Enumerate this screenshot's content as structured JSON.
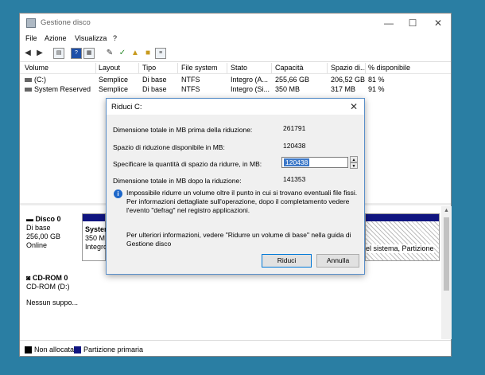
{
  "window": {
    "title": "Gestione disco",
    "controls": {
      "minimize": "—",
      "maximize": "☐",
      "close": "✕"
    }
  },
  "menu": [
    "File",
    "Azione",
    "Visualizza",
    "?"
  ],
  "toolbar": {
    "icons": [
      "back-arrow-icon",
      "forward-arrow-icon",
      "disk-list-icon",
      "help-icon",
      "properties-icon",
      "connect-icon",
      "check-icon",
      "folder-up-icon",
      "folder-new-icon",
      "view-icon"
    ]
  },
  "table": {
    "headers": [
      "Volume",
      "Layout",
      "Tipo",
      "File system",
      "Stato",
      "Capacità",
      "Spazio di...",
      "% disponibile"
    ],
    "rows": [
      [
        "(C:)",
        "Semplice",
        "Di base",
        "NTFS",
        "Integro (A...",
        "255,66 GB",
        "206,52 GB",
        "81 %"
      ],
      [
        "System Reserved",
        "Semplice",
        "Di base",
        "NTFS",
        "Integro (Si...",
        "350 MB",
        "317 MB",
        "91 %"
      ]
    ]
  },
  "disks": {
    "disk0": {
      "name": "Disco 0",
      "type": "Di base",
      "size": "256,00 GB",
      "status": "Online",
      "partition1": {
        "line1": "Syster",
        "line2": "350 M",
        "line3": "Integro"
      },
      "partition2": {
        "line1": "el sistema, Partizione"
      }
    },
    "cdrom": {
      "name": "CD-ROM 0",
      "type": "CD-ROM (D:)",
      "status": "Nessun suppo..."
    }
  },
  "legend": {
    "items": [
      {
        "label": "Non allocata",
        "color": "#000000"
      },
      {
        "label": "Partizione primaria",
        "color": "#101580"
      }
    ]
  },
  "dialog": {
    "title": "Riduci C:",
    "close": "✕",
    "total_before_label": "Dimensione totale in MB prima della riduzione:",
    "total_before_value": "261791",
    "available_label": "Spazio di riduzione disponibile in MB:",
    "available_value": "120438",
    "amount_label": "Specificare la quantità di spazio da ridurre, in MB:",
    "amount_value": "120438",
    "total_after_label": "Dimensione totale in MB dopo la riduzione:",
    "total_after_value": "141353",
    "info_text": "Impossibile ridurre un volume oltre il punto in cui si trovano eventuali file fissi. Per informazioni dettagliate sull'operazione, dopo il completamento vedere l'evento \"defrag\" nel registro applicazioni.",
    "more_info_text": "Per ulteriori informazioni, vedere \"Ridurre un volume di base\" nella guida di Gestione disco",
    "ok_label": "Riduci",
    "cancel_label": "Annulla"
  }
}
